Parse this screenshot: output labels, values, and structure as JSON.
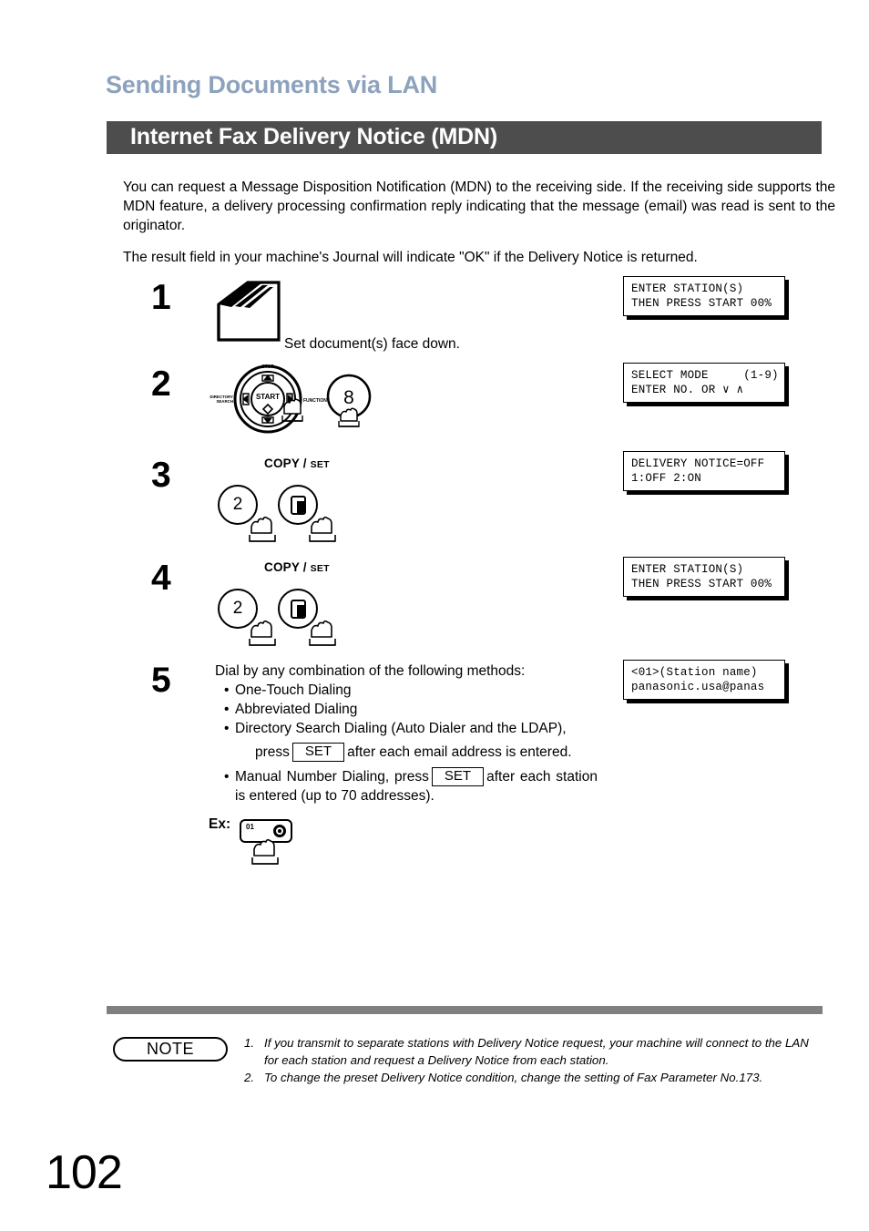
{
  "header": {
    "chapter_title": "Sending Documents via LAN",
    "section_title": "Internet Fax Delivery Notice (MDN)",
    "section_bar_color": "#4d4d4d",
    "chapter_title_color": "#8da2bd"
  },
  "intro": {
    "paragraph1": "You can request a Message Disposition Notification (MDN) to the receiving side. If the receiving side supports the MDN feature, a delivery processing confirmation reply indicating that the message (email) was read is sent to the originator.",
    "paragraph2": "The result field in your machine's Journal will indicate \"OK\" if the Delivery Notice is returned."
  },
  "steps": [
    {
      "number": "1",
      "caption": "Set document(s) face down.",
      "lcd_line1": "ENTER STATION(S)",
      "lcd_line2": "THEN PRESS START 00%"
    },
    {
      "number": "2",
      "key_label": "8",
      "dial": {
        "center": "START",
        "top": "STOP",
        "left": "DIRECTORY SEARCH",
        "right": "FUNCTION"
      },
      "lcd_line1": "SELECT MODE     (1-9)",
      "lcd_line2": "ENTER NO. OR ∨ ∧"
    },
    {
      "number": "3",
      "key_label": "2",
      "copyset_label_main": "COPY /",
      "copyset_label_small": "SET",
      "lcd_line1": "DELIVERY NOTICE=OFF",
      "lcd_line2": "1:OFF 2:ON"
    },
    {
      "number": "4",
      "key_label": "2",
      "copyset_label_main": "COPY /",
      "copyset_label_small": "SET",
      "lcd_line1": "ENTER STATION(S)",
      "lcd_line2": "THEN PRESS START 00%"
    },
    {
      "number": "5",
      "intro_line": "Dial by any combination of the following methods:",
      "methods": [
        "One-Touch Dialing",
        "Abbreviated Dialing"
      ],
      "method3_part1": "Directory Search Dialing  (Auto Dialer and the LDAP),",
      "method3_part2_pre": "press",
      "method3_setbox": "SET",
      "method3_part2_post": "after each email address is entered.",
      "method4_pre": "Manual Number Dialing, press",
      "method4_setbox": "SET",
      "method4_post": "after each station is entered (up to 70 addresses).",
      "example_label": "Ex:",
      "example_key_number": "01",
      "lcd_line1": "<01>(Station name)",
      "lcd_line2": "panasonic.usa@panas"
    }
  ],
  "note": {
    "badge": "NOTE",
    "items": [
      {
        "index": "1.",
        "text": "If you transmit to separate stations with Delivery Notice request, your machine will connect to the LAN for each station and request a Delivery Notice from each station."
      },
      {
        "index": "2.",
        "text": "To change the preset Delivery Notice condition, change the setting of Fax Parameter No.173."
      }
    ]
  },
  "footer": {
    "page_number": "102",
    "rule_color": "#808080"
  }
}
